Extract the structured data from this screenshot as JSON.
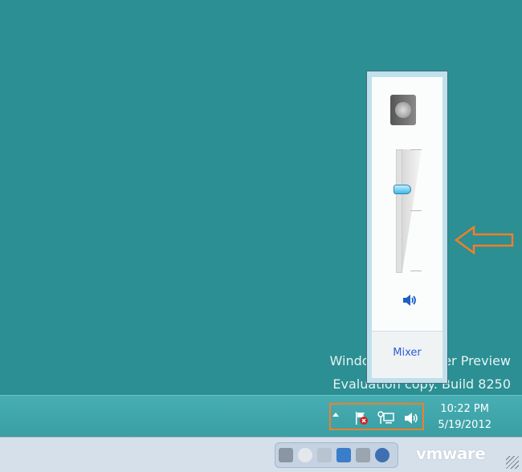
{
  "desktop": {
    "watermark_line1": "Windows Consumer Preview",
    "watermark_line2": "Evaluation copy. Build 8250"
  },
  "volume_popup": {
    "device_icon": "speaker-device-icon",
    "volume_percent": 67,
    "mute_icon": "speaker-volume-icon",
    "mixer_label": "Mixer"
  },
  "taskbar": {
    "show_hidden_icon": "chevron-up-icon",
    "tray_icons": [
      "action-center-flag-icon",
      "network-icon",
      "volume-icon"
    ],
    "time": "10:22 PM",
    "date": "5/19/2012"
  },
  "vmware_bar": {
    "logo": "vmware",
    "device_icons": [
      "hard-disk-icon",
      "cd-drive-icon",
      "floppy-icon",
      "network-adapter-icon",
      "printer-icon",
      "sound-card-icon"
    ]
  },
  "colors": {
    "highlight": "#f07f2a",
    "desktop": "#2b8f93"
  }
}
